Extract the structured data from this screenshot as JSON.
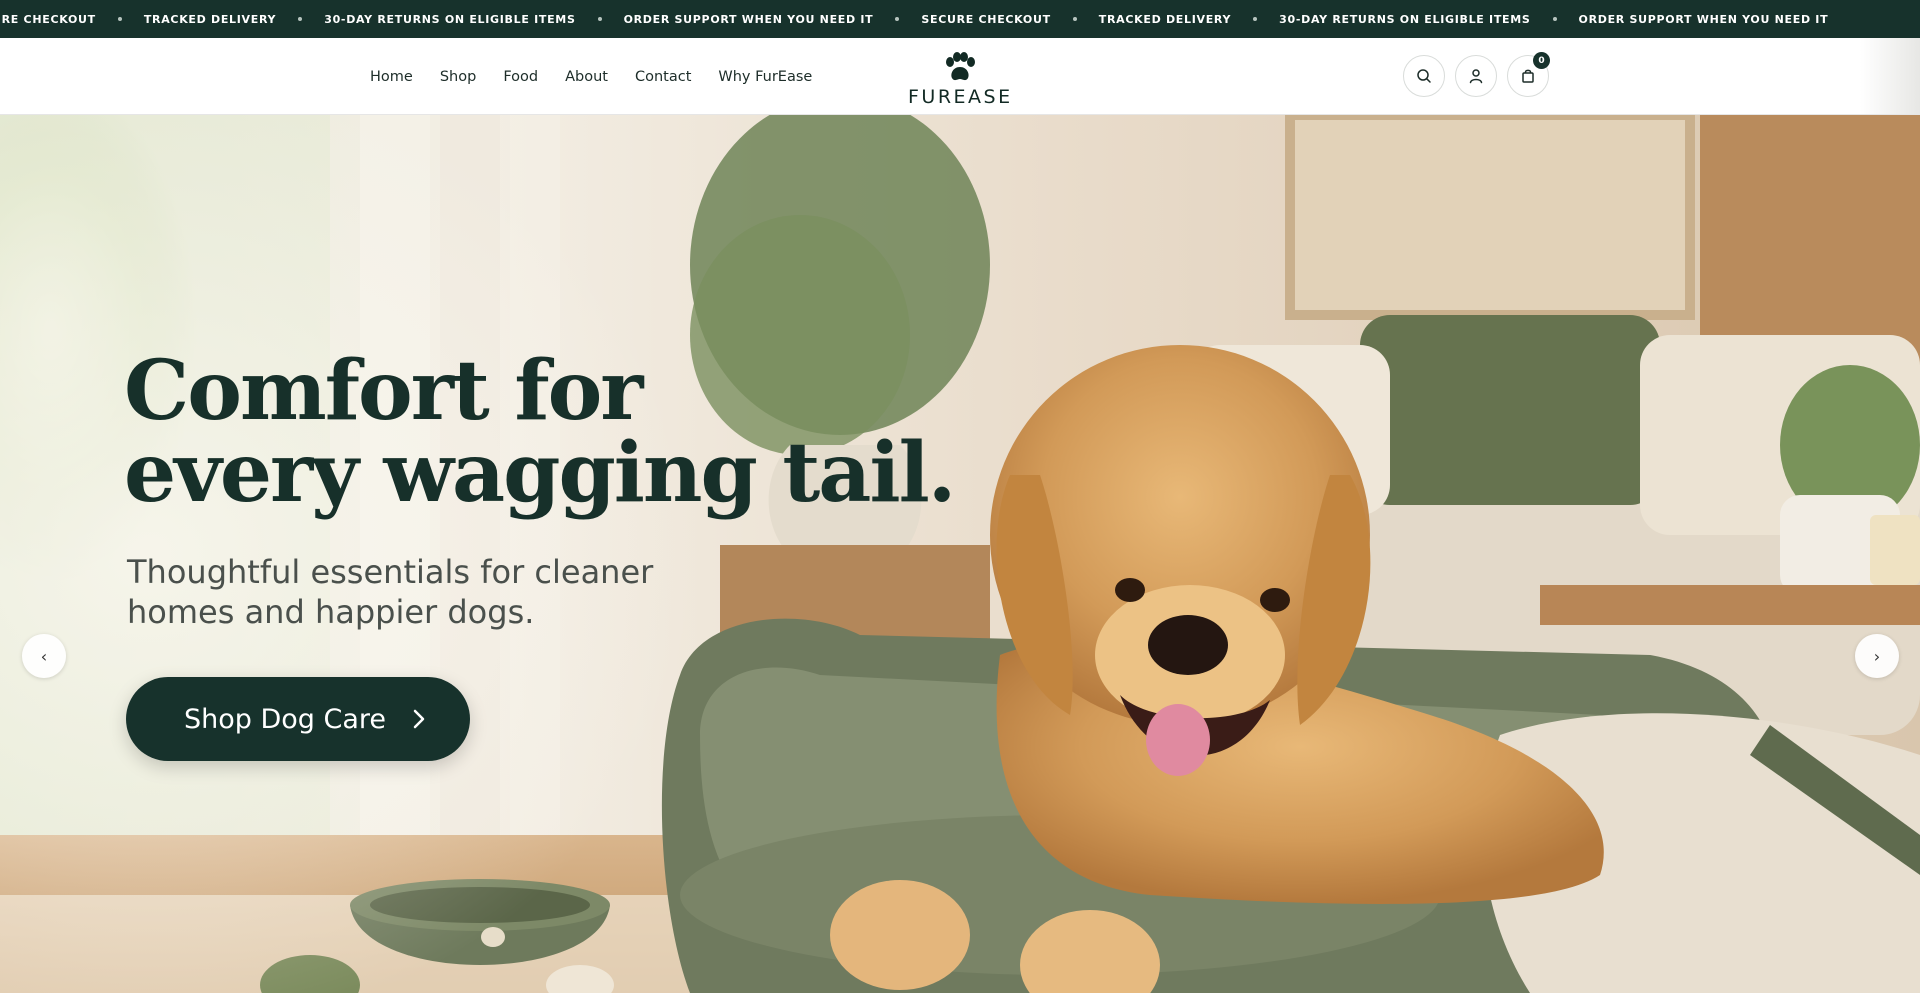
{
  "announcement": {
    "items": [
      "URE CHECKOUT",
      "TRACKED DELIVERY",
      "30-DAY RETURNS ON ELIGIBLE ITEMS",
      "ORDER SUPPORT WHEN YOU NEED IT",
      "SECURE CHECKOUT",
      "TRACKED DELIVERY",
      "30-DAY RETURNS ON ELIGIBLE ITEMS",
      "ORDER SUPPORT WHEN YOU NEED IT"
    ]
  },
  "nav": {
    "items": [
      "Home",
      "Shop",
      "Food",
      "About",
      "Contact",
      "Why FurEase"
    ]
  },
  "logo": {
    "text": "FUREASE"
  },
  "header_icons": {
    "search": "search-icon",
    "account": "user-icon",
    "cart": "shopping-bag-icon",
    "cart_count": "0"
  },
  "hero": {
    "title_line1": "Comfort for",
    "title_line2": "every wagging tail.",
    "subtitle_line1": "Thoughtful essentials for cleaner",
    "subtitle_line2": "homes and happier dogs.",
    "cta_label": "Shop Dog Care",
    "prev_label": "‹",
    "next_label": "›"
  },
  "colors": {
    "brand_dark": "#17322c",
    "accent_green": "#6e7a5c",
    "dog_golden": "#d29a58"
  }
}
